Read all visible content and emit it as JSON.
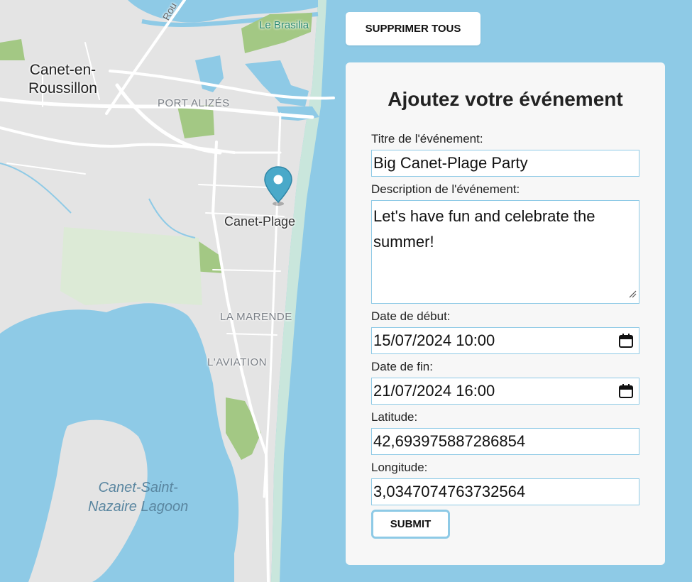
{
  "map": {
    "labels": {
      "city": "Canet-en-\nRoussillon",
      "port": "PORT ALIZÉS",
      "marker_place": "Canet-Plage",
      "marende": "LA MARENDE",
      "aviation": "L'AVIATION",
      "lagoon": "Canet-Saint-\nNazaire Lagoon",
      "poi": "Le Brasilia",
      "road_fragment": "Rou"
    },
    "marker": {
      "icon": "map-pin-icon",
      "color": "#4aa9c9"
    },
    "colors": {
      "water": "#8ecae6",
      "land": "#e4e4e4",
      "park": "#a3c884",
      "beach": "#c9e6dc"
    }
  },
  "toolbar": {
    "delete_all_label": "SUPPRIMER TOUS"
  },
  "form": {
    "title": "Ajoutez votre événement",
    "title_label": "Titre de l'événement:",
    "title_value": "Big Canet-Plage Party",
    "description_label": "Description de l'événement:",
    "description_value": "Let's have fun and celebrate the summer!",
    "start_label": "Date de début:",
    "start_value": "15/07/2024 10:00",
    "end_label": "Date de fin:",
    "end_value": "21/07/2024 16:00",
    "latitude_label": "Latitude:",
    "latitude_value": "42,693975887286854",
    "longitude_label": "Longitude:",
    "longitude_value": "3,0347074763732564",
    "submit_label": "SUBMIT",
    "calendar_icon": "calendar-icon"
  }
}
